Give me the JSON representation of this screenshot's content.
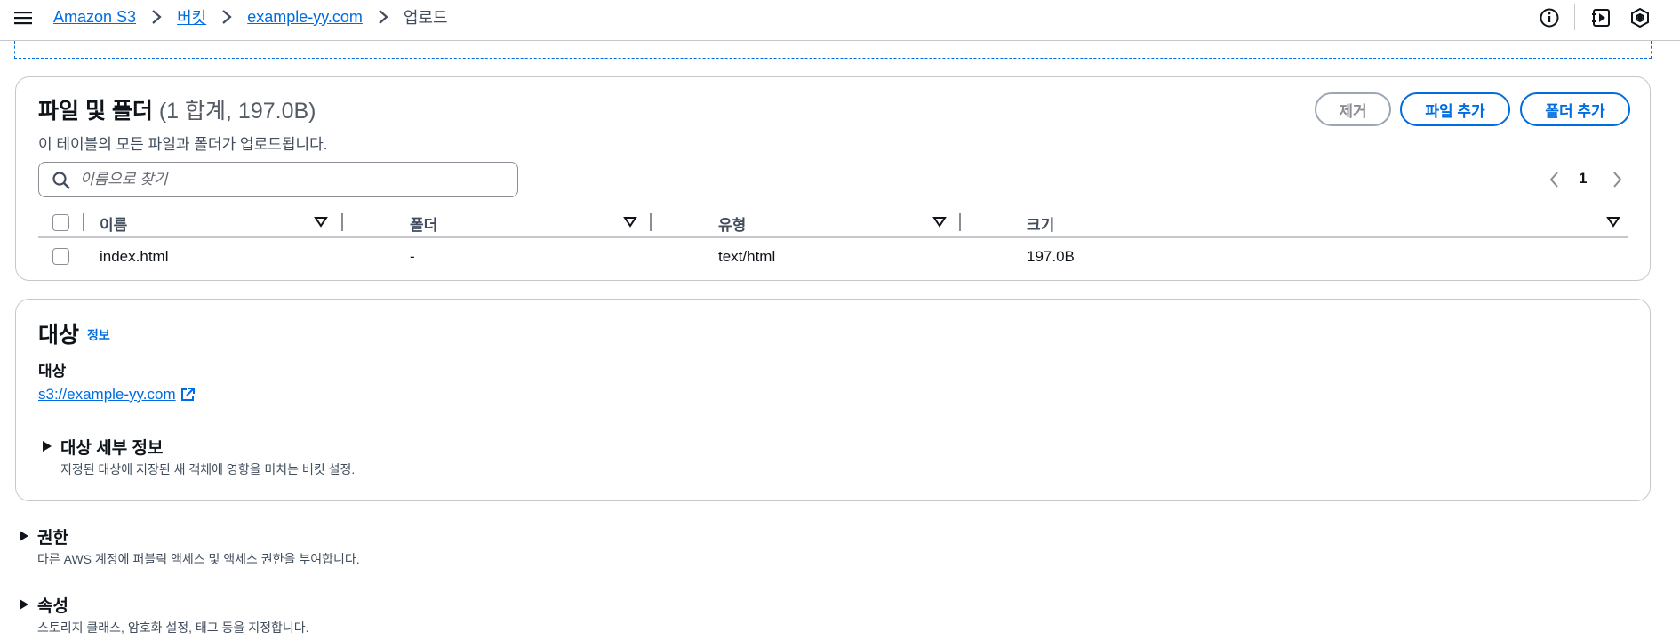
{
  "breadcrumb": {
    "items": [
      "Amazon S3",
      "버킷",
      "example-yy.com"
    ],
    "current": "업로드"
  },
  "files_section": {
    "title": "파일 및 폴더",
    "count": "(1 합계, 197.0B)",
    "description": "이 테이블의 모든 파일과 폴더가 업로드됩니다.",
    "buttons": {
      "remove": "제거",
      "add_file": "파일 추가",
      "add_folder": "폴더 추가"
    },
    "search": {
      "placeholder": "이름으로 찾기",
      "value": ""
    },
    "pagination": {
      "current_page": "1"
    },
    "columns": [
      "이름",
      "폴더",
      "유형",
      "크기"
    ],
    "rows": [
      {
        "name": "index.html",
        "folder": "-",
        "type": "text/html",
        "size": "197.0B"
      }
    ]
  },
  "target_section": {
    "title": "대상",
    "info_link": "정보",
    "label": "대상",
    "url": "s3://example-yy.com",
    "details": {
      "title": "대상 세부 정보",
      "description": "지정된 대상에 저장된 새 객체에 영향을 미치는 버킷 설정."
    }
  },
  "permissions": {
    "title": "권한",
    "description": "다른 AWS 계정에 퍼블릭 액세스 및 액세스 권한을 부여합니다."
  },
  "properties": {
    "title": "속성",
    "description": "스토리지 클래스, 암호화 설정, 태그 등을 지정합니다."
  },
  "icons": {
    "menu": "hamburger-menu-icon",
    "info": "info-icon",
    "notifications": "notifications-panel-icon",
    "settings": "settings-icon",
    "search": "search-icon",
    "external_link": "external-link-icon"
  },
  "colors": {
    "accent": "#006ce0",
    "text": "#0f141a",
    "muted": "#414d5c",
    "border": "#c6c6cd"
  }
}
